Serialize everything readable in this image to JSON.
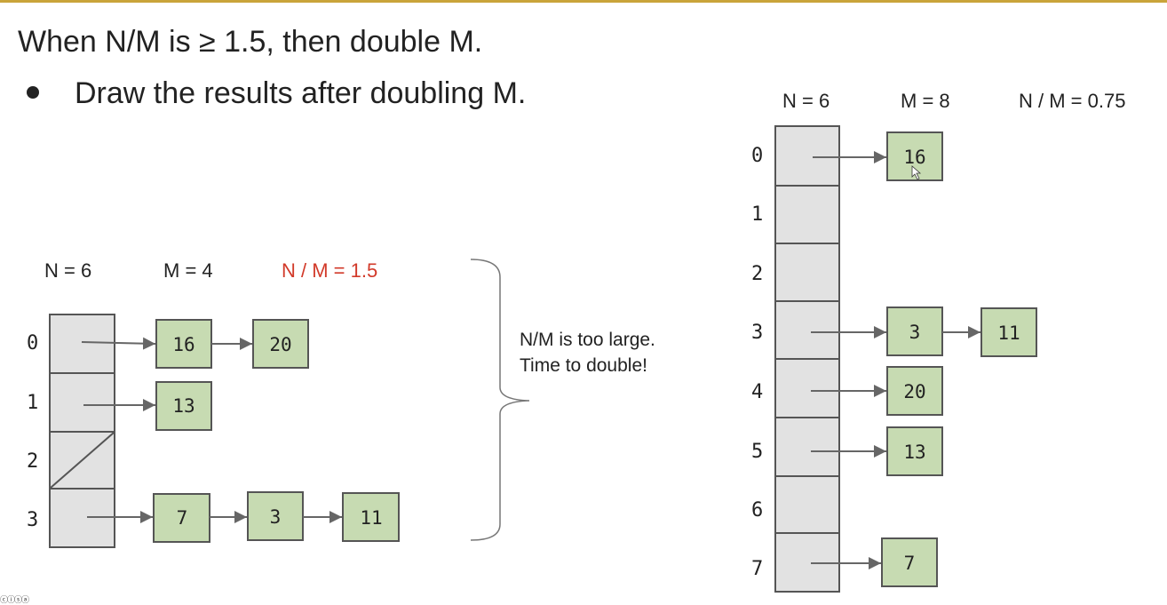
{
  "title": "When N/M is ≥ 1.5, then double M.",
  "bullet": "Draw the results after doubling M.",
  "left_table": {
    "n_label": "N = 6",
    "m_label": "M = 4",
    "ratio_label": "N / M = 1.5",
    "ratio_color": "#d23a2a",
    "indices": [
      "0",
      "1",
      "2",
      "3"
    ],
    "buckets": [
      [
        "16",
        "20"
      ],
      [
        "13"
      ],
      [],
      [
        "7",
        "3",
        "11"
      ]
    ]
  },
  "note": {
    "line1": "N/M is too large.",
    "line2": "Time to double!"
  },
  "right_table": {
    "n_label": "N = 6",
    "m_label": "M = 8",
    "ratio_label": "N / M = 0.75",
    "indices": [
      "0",
      "1",
      "2",
      "3",
      "4",
      "5",
      "6",
      "7"
    ],
    "buckets": [
      [
        "16"
      ],
      [],
      [],
      [
        "3",
        "11"
      ],
      [
        "20"
      ],
      [
        "13"
      ],
      [],
      [
        "7"
      ]
    ]
  },
  "colors": {
    "node_fill": "#c7dbb2",
    "cell_fill": "#e2e2e2",
    "accent_bar": "#c9a43a"
  },
  "footer_icons": "cc-by-nc-sa-icons"
}
